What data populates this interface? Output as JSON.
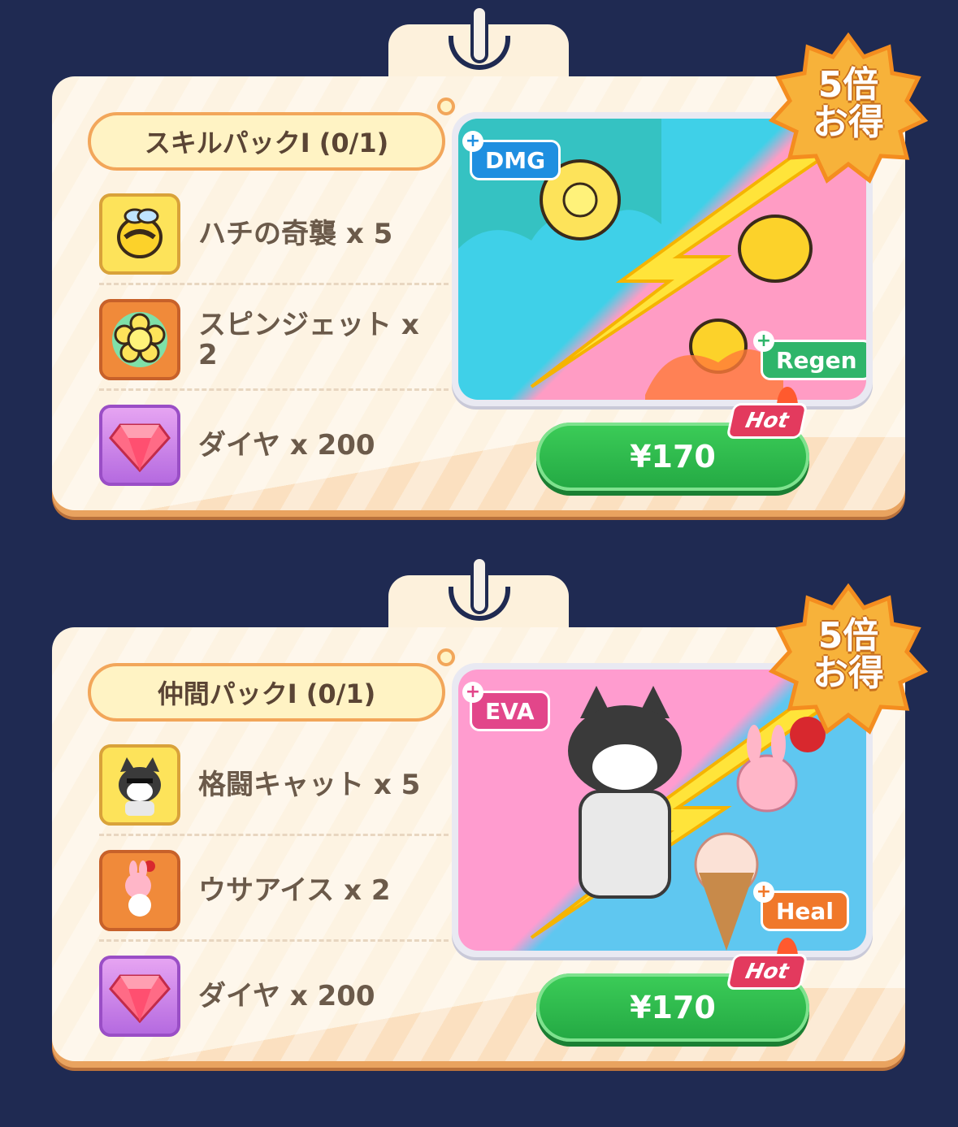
{
  "packs": [
    {
      "title": "スキルパックI (0/1)",
      "items": [
        {
          "label": "ハチの奇襲 x 5",
          "icon": "bee-icon"
        },
        {
          "label": "スピンジェット x 2",
          "icon": "flower-icon"
        },
        {
          "label": "ダイヤ x 200",
          "icon": "diamond-icon"
        }
      ],
      "tag_left": "DMG",
      "tag_right": "Regen",
      "badge": "5倍\nお得",
      "badge_line1": "5倍",
      "badge_line2": "お得",
      "price": "¥170",
      "hot_label": "Hot"
    },
    {
      "title": "仲間パックI (0/1)",
      "items": [
        {
          "label": "格闘キャット x 5",
          "icon": "cat-icon"
        },
        {
          "label": "ウサアイス x 2",
          "icon": "bunny-icecream-icon"
        },
        {
          "label": "ダイヤ x 200",
          "icon": "diamond-icon"
        }
      ],
      "tag_left": "EVA",
      "tag_right": "Heal",
      "badge_line1": "5倍",
      "badge_line2": "お得",
      "price": "¥170",
      "hot_label": "Hot"
    }
  ],
  "colors": {
    "background": "#1f2a52",
    "card": "#fdf3e2",
    "button": "#2dbb4e",
    "badge": "#f7b23a",
    "hot": "#e33a5e"
  }
}
